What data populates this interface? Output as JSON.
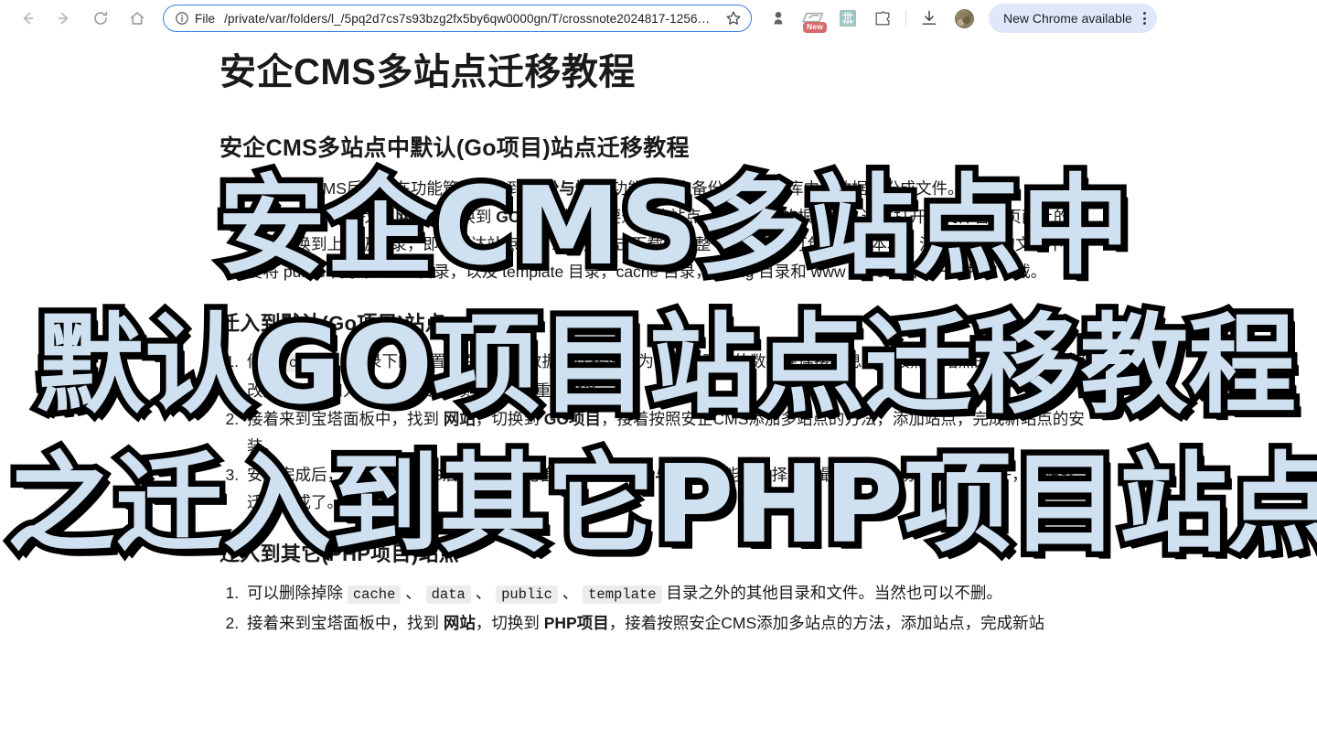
{
  "browser": {
    "nav": {
      "back_icon": "arrow-left-icon",
      "forward_icon": "arrow-right-icon",
      "reload_icon": "reload-icon",
      "home_icon": "home-icon"
    },
    "omnibox": {
      "info_icon": "info-circle-icon",
      "scheme_label": "File",
      "url": "/private/var/folders/l_/5pq2d7cs7s93bzg2fx5by6qw0000gn/T/crossnote2024817-1256…",
      "bookmark_icon": "star-icon"
    },
    "actions": [
      {
        "name": "profile-pin-icon",
        "label": ""
      },
      {
        "name": "extension-new-icon",
        "label": "New"
      },
      {
        "name": "translate-extension-icon",
        "label": ""
      },
      {
        "name": "extensions-puzzle-icon",
        "label": ""
      },
      {
        "name": "download-icon",
        "label": ""
      },
      {
        "name": "avatar",
        "label": ""
      }
    ],
    "update_pill": {
      "label": "New Chrome available",
      "menu_icon": "kebab-menu-icon"
    }
  },
  "document": {
    "title": "安企CMS多站点迁移教程",
    "section_1": {
      "heading": "安企CMS多站点中默认(Go项目)站点迁移教程",
      "items": [
        {
          "prefix": "登录安企CMS后台，在功能管理中找到 ",
          "bold": "备份与恢复",
          "suffix": " 功能，点击备份，将数据库中的数据备份成文件。"
        },
        {
          "prefix": "回到宝塔面板，找到 ",
          "bold": "网站",
          "mid": "，切换到 ",
          "bold2": "GO项目",
          "suffix": " 找到需要迁移的站点，点击对应的根目录，通过打开的文件管理页面上的目录，切换到上一级目录，即可到达站点根目录，并点击下载，将整个站点目录打包下载到本地。注意，打包的文件中，要将 public 目录和 data 目录，以及 template 目录，cache 目录，config 目录和 www 和 root 目录一并打包下载。"
        }
      ]
    },
    "section_2": {
      "heading": "迁入到默认(Go项目)站点",
      "items": [
        {
          "prefix": "修改 ",
          "bold": "config",
          "suffix": " 目录下的配置文件，修改数据库连接信息为新站点已有的数据库连接信息，并按照新站点的目录结构，修改文件目录和入口需要的配置项，保存并重启服务。"
        },
        {
          "prefix": "接着来到宝塔面板中，找到 ",
          "bold": "网站",
          "mid": "，切换到 ",
          "bold2": "GO项目",
          "suffix": "，接着按照安企CMS添加多站点的方法，添加站点，完成新站点的安装。"
        },
        {
          "prefix": "安装完成后，登录安企CMS后台，在功能管理中找到 ",
          "bold": "备份与恢复",
          "suffix": " 功能，选择恢复最后一条备份记录，这样子，网站就迁移完成了。"
        }
      ]
    },
    "section_3": {
      "heading": "迁入到其它(PHP项目)站点",
      "items": [
        {
          "prefix": "可以删除掉除 ",
          "code": [
            "cache",
            "data",
            "public",
            "template"
          ],
          "sep": " 、 ",
          "suffix": " 目录之外的其他目录和文件。当然也可以不删。"
        },
        {
          "prefix": "接着来到宝塔面板中，找到 ",
          "bold": "网站",
          "mid": "，切换到 ",
          "bold2": "PHP项目",
          "suffix": "，接着按照安企CMS添加多站点的方法，添加站点，完成新站"
        }
      ]
    }
  },
  "caption_overlay": {
    "line1": "安企CMS多站点中",
    "line2": "默认GO项目站点迁移教程",
    "line3": "之迁入到其它PHP项目站点",
    "fill_color": "#cfe0f0",
    "stroke_color": "#000000"
  }
}
